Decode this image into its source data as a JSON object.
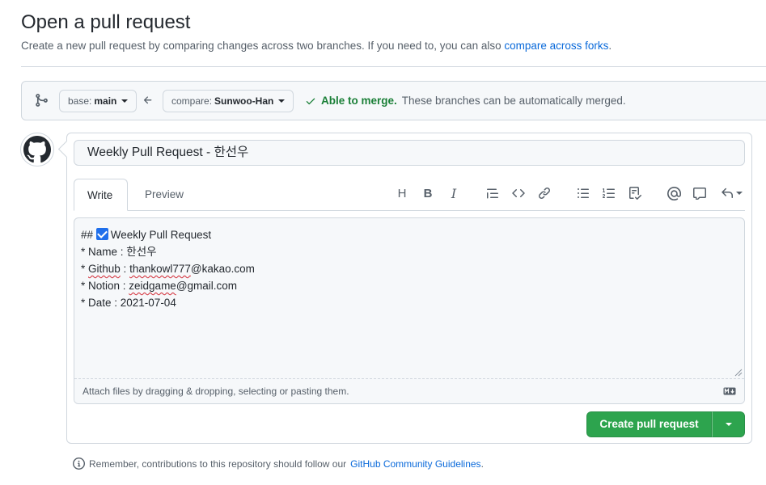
{
  "header": {
    "title": "Open a pull request",
    "subtitle": "Create a new pull request by comparing changes across two branches. If you need to, you can also",
    "subtitle_link": "compare across forks",
    "subtitle_end": "."
  },
  "range": {
    "base_label": "base:",
    "base_value": "main",
    "compare_label": "compare:",
    "compare_value": "Sunwoo-Han",
    "merge_ok": "Able to merge.",
    "merge_desc": "These branches can be automatically merged."
  },
  "pr": {
    "title_value": "Weekly Pull Request - 한선우",
    "tabs": {
      "write": "Write",
      "preview": "Preview"
    },
    "toolbar": {
      "heading": "H",
      "bold": "B",
      "italic": "I",
      "icons": [
        "quote-icon",
        "code-icon",
        "link-icon",
        "bulleted-list-icon",
        "numbered-list-icon",
        "task-list-icon",
        "mention-icon",
        "reference-icon",
        "reply-icon"
      ]
    },
    "body": {
      "line1_prefix": "## ",
      "line1_text": "Weekly Pull Request",
      "line2": "* Name : 한선우",
      "line3_prefix": "* ",
      "line3_word": "Github",
      "line3_mid": " : ",
      "line3_user": "thankowl777",
      "line3_domain": "@kakao.com",
      "line4_prefix": "* Notion : ",
      "line4_user": "zeidgame",
      "line4_domain": "@gmail.com",
      "line5": "* Date : 2021-07-04"
    },
    "attach_text": "Attach files by dragging & dropping, selecting or pasting them.",
    "create_button": "Create pull request"
  },
  "footer": {
    "text": "Remember, contributions to this repository should follow our",
    "link": "GitHub Community Guidelines",
    "end": "."
  },
  "colors": {
    "primary_green": "#2da44e",
    "merge_green": "#1a7f37",
    "link_blue": "#0969da",
    "border": "#d0d7de"
  }
}
